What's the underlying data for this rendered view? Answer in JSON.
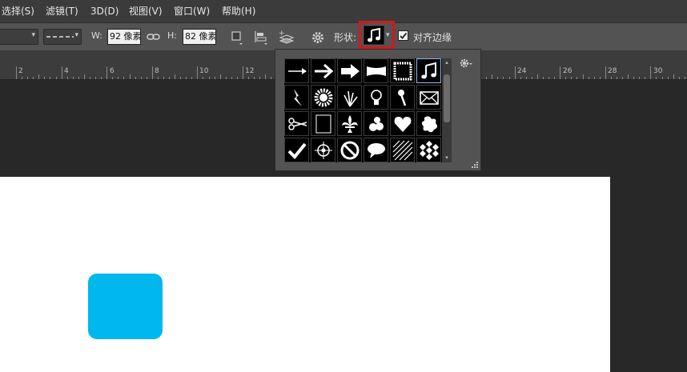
{
  "menu": [
    "选择(S)",
    "滤镜(T)",
    "3D(D)",
    "视图(V)",
    "窗口(W)",
    "帮助(H)"
  ],
  "options": {
    "w_label": "W:",
    "w_value": "92 像素",
    "h_label": "H:",
    "h_value": "82 像素",
    "shape_label": "形状:",
    "align_edges_label": "对齐边缘",
    "align_edges_checked": true,
    "highlight_color": "#d4181c"
  },
  "ruler_labels": [
    "2",
    "4",
    "6",
    "8",
    "10",
    "12",
    "24",
    "26",
    "28",
    "30"
  ],
  "shape_picker": {
    "rows": [
      [
        "arrow-thin-icon",
        "arrow-bold-icon",
        "arrow-block-icon",
        "banner-icon",
        "frame-stamp-icon",
        "music-note-icon"
      ],
      [
        "lightning-icon",
        "burst-icon",
        "grass-icon",
        "lightbulb-icon",
        "pushpin-icon",
        "envelope-icon"
      ],
      [
        "scissors-icon",
        "frame-icon",
        "fleur-de-lis-icon",
        "leaf-ornament-icon",
        "heart-icon",
        "splat-icon"
      ],
      [
        "checkmark-icon",
        "target-icon",
        "no-sign-icon",
        "speech-bubble-icon",
        "diagonal-lines-icon",
        "checker-icon"
      ]
    ],
    "selected": "music-note-icon"
  },
  "colors": {
    "shape_fill": "#00b7ee",
    "canvas": "#ffffff",
    "workspace": "#282828"
  }
}
